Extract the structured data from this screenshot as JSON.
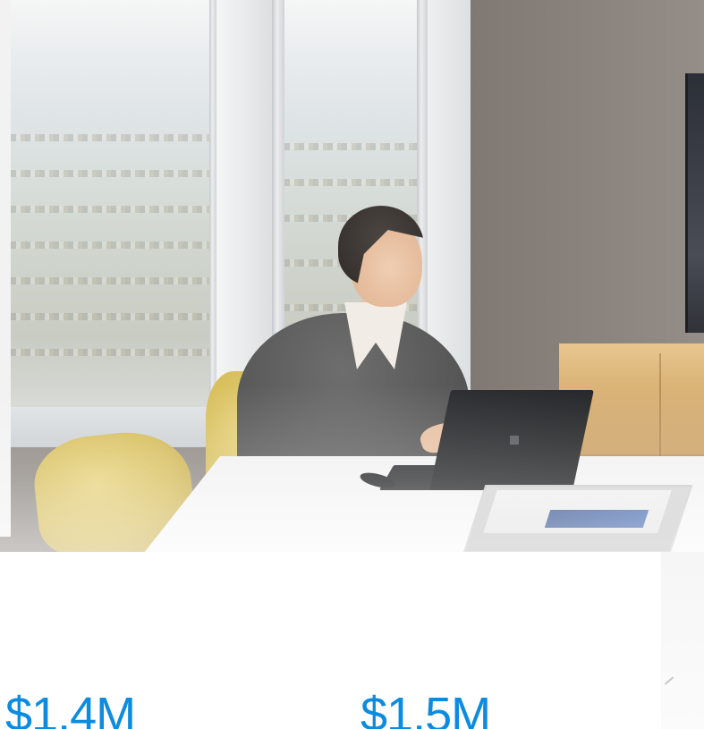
{
  "hero": {
    "image_icon": "office-photo-woman-with-laptop"
  },
  "stats": [
    {
      "value": "$1.4M"
    },
    {
      "value": "$1.5M"
    }
  ],
  "colors": {
    "accent": "#0c8ce0",
    "chair": "#d6bd59",
    "credenza": "#d9b275",
    "background": "#ffffff"
  }
}
